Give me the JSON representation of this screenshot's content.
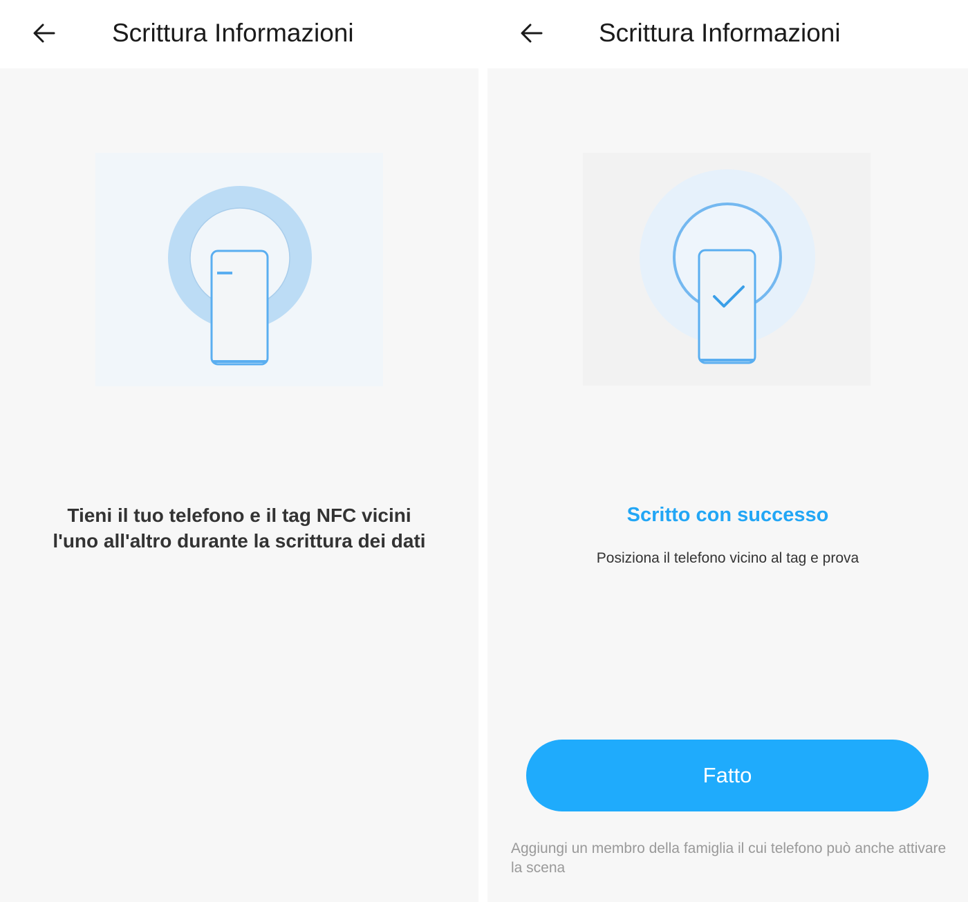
{
  "left_screen": {
    "title": "Scrittura Informazioni",
    "instruction": "Tieni il tuo telefono e il tag NFC vicini l'uno all'altro durante la scrittura dei dati"
  },
  "right_screen": {
    "title": "Scrittura Informazioni",
    "success_title": "Scritto con successo",
    "success_subtitle": "Posiziona il telefono vicino al tag e prova",
    "done_button": "Fatto",
    "footnote": "Aggiungi un membro della famiglia il cui telefono può anche attivare la scena"
  },
  "colors": {
    "accent": "#1fabfc",
    "success_text": "#22a6f5",
    "illustration_blue": "#5aaef0",
    "ring_light": "#bcdcf5",
    "content_bg": "#f7f7f7"
  },
  "icons": {
    "back": "arrow-left-icon",
    "check": "checkmark-icon"
  }
}
